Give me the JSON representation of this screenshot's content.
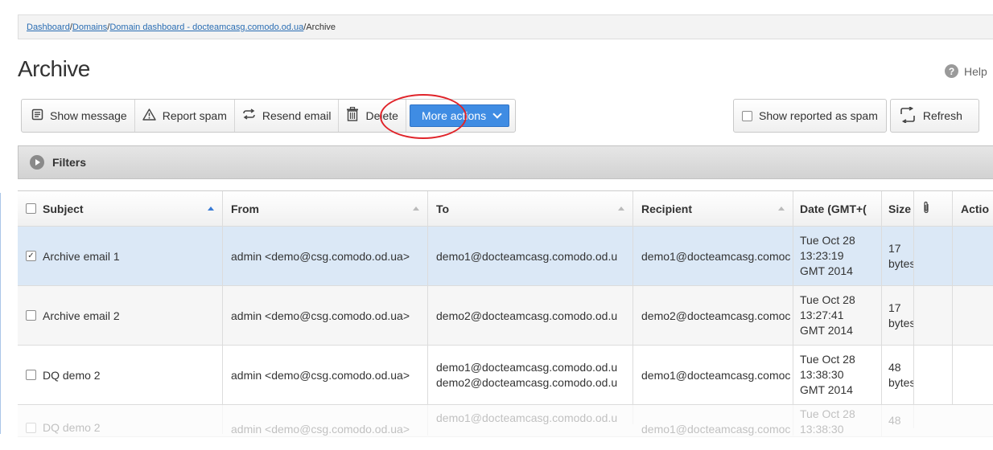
{
  "breadcrumb": {
    "items": [
      "Dashboard",
      "Domains",
      "Domain dashboard - docteamcasg.comodo.od.ua"
    ],
    "current": "Archive",
    "separator": " / "
  },
  "page": {
    "title": "Archive",
    "help_label": "Help"
  },
  "toolbar": {
    "show_message": "Show message",
    "report_spam": "Report spam",
    "resend_email": "Resend email",
    "delete": "Delete",
    "more_actions": "More actions"
  },
  "toolbar_right": {
    "show_reported_label": "Show reported as spam",
    "show_reported_checked": false,
    "refresh": "Refresh"
  },
  "filters": {
    "label": "Filters"
  },
  "table": {
    "columns": {
      "subject": "Subject",
      "from": "From",
      "to": "To",
      "recipient": "Recipient",
      "date": "Date (GMT+(",
      "size": "Size",
      "actions": "Actio"
    },
    "rows": [
      {
        "checked": true,
        "subject": "Archive email 1",
        "from": "admin <demo@csg.comodo.od.ua>",
        "to": [
          "demo1@docteamcasg.comodo.od.u"
        ],
        "recipient": "demo1@docteamcasg.comoc",
        "date": [
          "Tue Oct 28",
          "13:23:19",
          "GMT 2014"
        ],
        "size": [
          "17",
          "bytes"
        ]
      },
      {
        "checked": false,
        "subject": "Archive email 2",
        "from": "admin <demo@csg.comodo.od.ua>",
        "to": [
          "demo2@docteamcasg.comodo.od.u"
        ],
        "recipient": "demo2@docteamcasg.comoc",
        "date": [
          "Tue Oct 28",
          "13:27:41",
          "GMT 2014"
        ],
        "size": [
          "17",
          "bytes"
        ]
      },
      {
        "checked": false,
        "subject": "DQ demo 2",
        "from": "admin <demo@csg.comodo.od.ua>",
        "to": [
          "demo1@docteamcasg.comodo.od.u",
          "demo2@docteamcasg.comodo.od.u"
        ],
        "recipient": "demo1@docteamcasg.comoc",
        "date": [
          "Tue Oct 28",
          "13:38:30",
          "GMT 2014"
        ],
        "size": [
          "48",
          "bytes"
        ]
      },
      {
        "checked": false,
        "subject": "DQ demo 2",
        "from": "admin <demo@csg.comodo.od.ua>",
        "to": [
          "demo1@docteamcasg.comodo.od.u"
        ],
        "recipient": "demo1@docteamcasg.comoc",
        "date": [
          "Tue Oct 28",
          "13:38:30"
        ],
        "size": [
          "48"
        ]
      }
    ]
  },
  "colors": {
    "accent": "#3f8ce3",
    "selected_row": "#dbe8f6",
    "highlight_ring": "#e0242a",
    "link": "#2a6db3"
  }
}
